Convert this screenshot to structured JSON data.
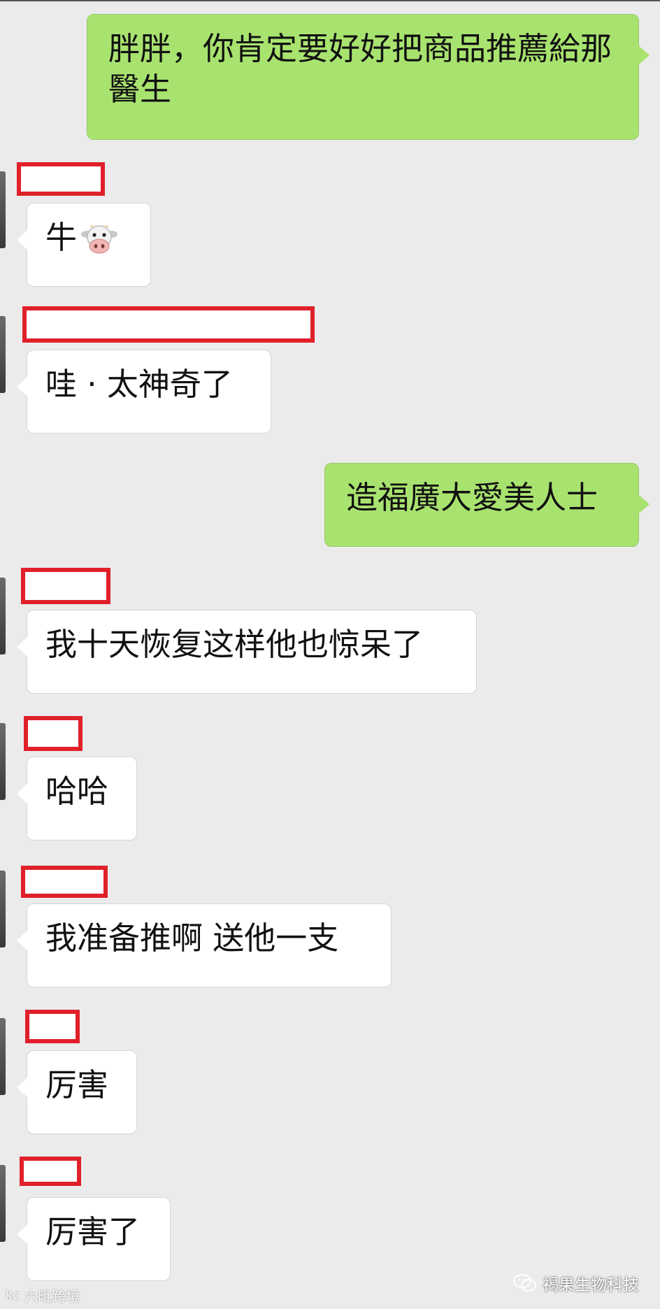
{
  "messages": [
    {
      "side": "out",
      "text": "胖胖，你肯定要好好把商品推薦給那醫生"
    },
    {
      "side": "in",
      "text": "牛"
    },
    {
      "side": "in",
      "text": "哇 · 太神奇了"
    },
    {
      "side": "out",
      "text": "造福廣大愛美人士"
    },
    {
      "side": "in",
      "text": "我十天恢复这样他也惊呆了"
    },
    {
      "side": "in",
      "text": "哈哈"
    },
    {
      "side": "in",
      "text": "我准备推啊  送他一支"
    },
    {
      "side": "in",
      "text": "厉害"
    },
    {
      "side": "in",
      "text": "厉害了"
    }
  ],
  "icons": {
    "cow": "cow-face-icon",
    "wechat": "wechat-icon"
  },
  "colors": {
    "outgoing_bubble": "#a9e36f",
    "incoming_bubble": "#ffffff",
    "redaction": "#e0202a",
    "background": "#ebebeb"
  },
  "watermark": {
    "right": "褐果生物科技",
    "left": "六毗跨境"
  }
}
